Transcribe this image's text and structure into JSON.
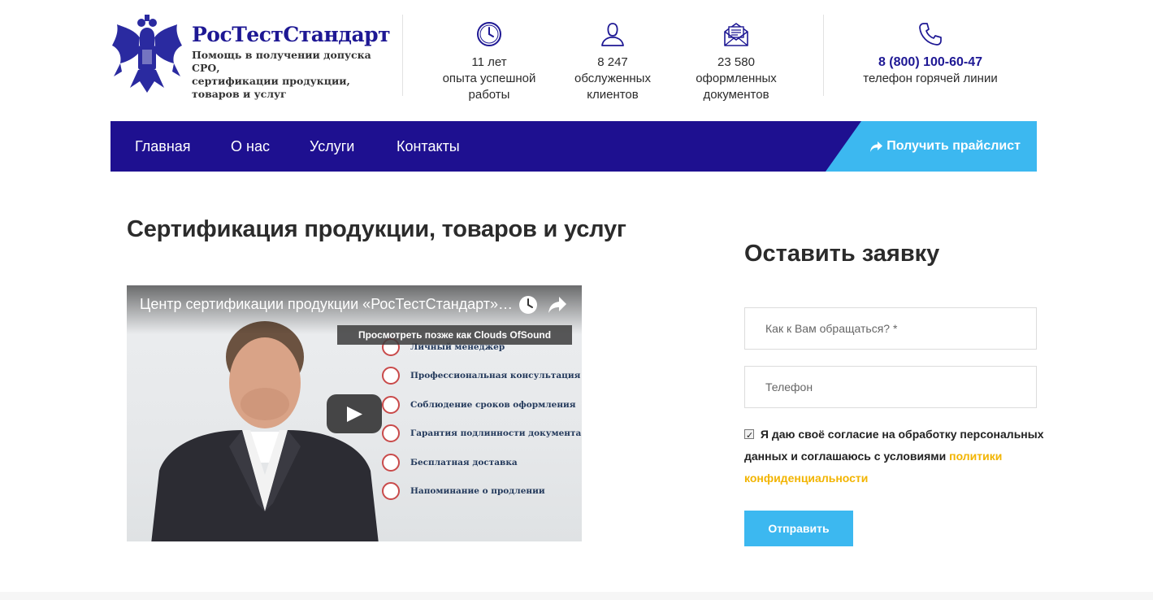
{
  "header": {
    "brand_name": "РосТестСтандарт",
    "brand_subtitle": [
      "Помощь в получении допуска СРО,",
      "сертификации продукции,",
      "товаров и услуг"
    ],
    "stats": [
      {
        "icon": "clock-icon",
        "lines": [
          "11 лет",
          "опыта успешной",
          "работы"
        ]
      },
      {
        "icon": "user-icon",
        "lines": [
          "8 247",
          "обслуженных",
          "клиентов"
        ]
      },
      {
        "icon": "envelope-icon",
        "lines": [
          "23 580",
          "оформленных",
          "документов"
        ]
      }
    ],
    "phone": {
      "icon": "phone-icon",
      "number": "8 (800) 100-60-47",
      "caption": "телефон горячей линии"
    }
  },
  "nav": {
    "items": [
      "Главная",
      "О нас",
      "Услуги",
      "Контакты"
    ],
    "cta_label": "Получить прайслист"
  },
  "main": {
    "title": "Сертификация продукции, товаров и услуг",
    "video": {
      "title": "Центр сертификации продукции «РосТестСтандарт» - отзывы",
      "tooltip": "Просмотреть позже как Clouds OfSound",
      "features": [
        "Личный менеджер",
        "Профессиональная консультация",
        "Соблюдение сроков оформления",
        "Гарантия подлинности документа",
        "Бесплатная доставка",
        "Напоминание о продлении"
      ]
    }
  },
  "form": {
    "title": "Оставить заявку",
    "name_placeholder": "Как к Вам обращаться? *",
    "phone_placeholder": "Телефон",
    "consent_text": "Я даю своё согласие на обработку персональных данных и соглашаюсь с условиями",
    "consent_link": "политики конфиденциальности",
    "consent_checked": true,
    "submit_label": "Отправить"
  },
  "colors": {
    "brand_blue": "#1e1090",
    "accent_sky": "#3cb8f0",
    "link_yellow": "#f2b400"
  }
}
